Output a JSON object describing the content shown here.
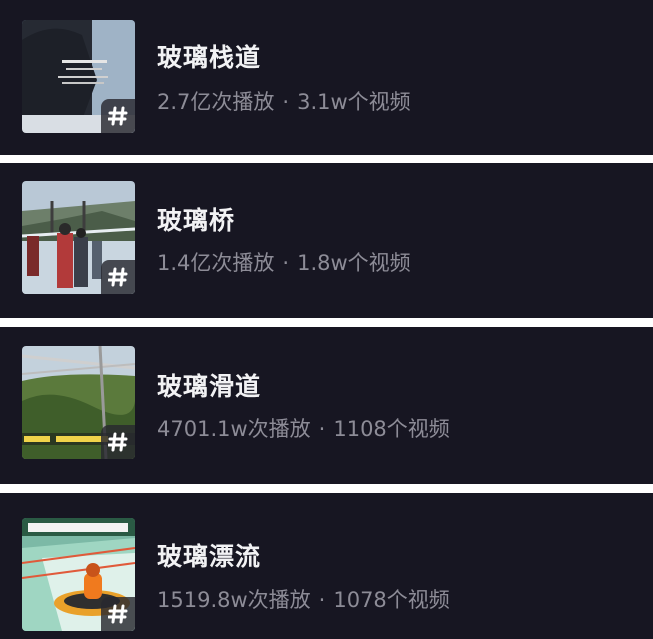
{
  "topics": [
    {
      "title": "玻璃栈道",
      "plays": "2.7亿次播放",
      "videos": "3.1w个视频",
      "thumb_icon": "glass-walkway-thumbnail"
    },
    {
      "title": "玻璃桥",
      "plays": "1.4亿次播放",
      "videos": "1.8w个视频",
      "thumb_icon": "glass-bridge-thumbnail"
    },
    {
      "title": "玻璃滑道",
      "plays": "4701.1w次播放",
      "videos": "1108个视频",
      "thumb_icon": "glass-slide-thumbnail"
    },
    {
      "title": "玻璃漂流",
      "plays": "1519.8w次播放",
      "videos": "1078个视频",
      "thumb_icon": "glass-rafting-thumbnail"
    }
  ],
  "separator": "·",
  "hashtag_glyph": "#",
  "colors": {
    "card_bg": "#171622",
    "title": "#f2f2f4",
    "meta": "#8d8c97",
    "divider": "#ffffff"
  }
}
